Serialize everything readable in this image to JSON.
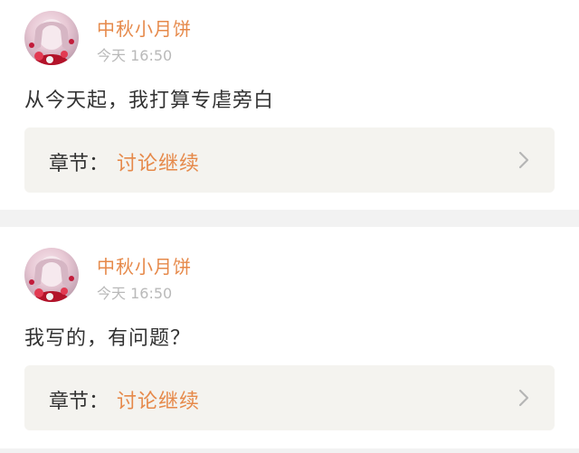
{
  "posts": [
    {
      "username": "中秋小月饼",
      "time": "今天 16:50",
      "message": "从今天起，我打算专虐旁白",
      "chapter_prefix": "章节：",
      "chapter_title": "讨论继续"
    },
    {
      "username": "中秋小月饼",
      "time": "今天 16:50",
      "message": "我写的，有问题？",
      "chapter_prefix": "章节：",
      "chapter_title": "讨论继续"
    }
  ],
  "colors": {
    "username": "#e6894a",
    "time": "#b9b9b9",
    "text": "#333333",
    "chapter_bg": "#f4f3ef",
    "divider": "#f2f2f2"
  },
  "icons": {
    "chevron": "chevron-right-icon",
    "avatar": "user-avatar"
  }
}
